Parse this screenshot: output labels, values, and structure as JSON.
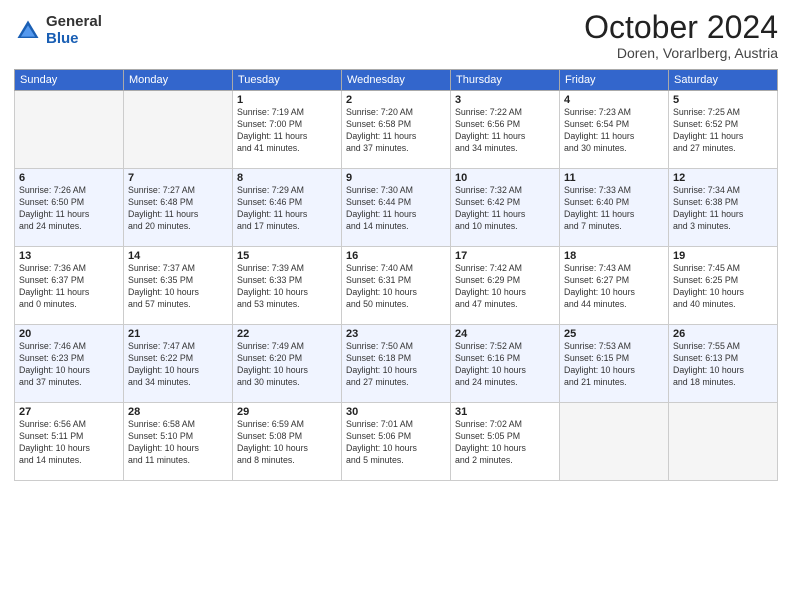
{
  "header": {
    "logo_general": "General",
    "logo_blue": "Blue",
    "month_title": "October 2024",
    "subtitle": "Doren, Vorarlberg, Austria"
  },
  "weekdays": [
    "Sunday",
    "Monday",
    "Tuesday",
    "Wednesday",
    "Thursday",
    "Friday",
    "Saturday"
  ],
  "weeks": [
    [
      {
        "day": "",
        "details": []
      },
      {
        "day": "",
        "details": []
      },
      {
        "day": "1",
        "details": [
          "Sunrise: 7:19 AM",
          "Sunset: 7:00 PM",
          "Daylight: 11 hours",
          "and 41 minutes."
        ]
      },
      {
        "day": "2",
        "details": [
          "Sunrise: 7:20 AM",
          "Sunset: 6:58 PM",
          "Daylight: 11 hours",
          "and 37 minutes."
        ]
      },
      {
        "day": "3",
        "details": [
          "Sunrise: 7:22 AM",
          "Sunset: 6:56 PM",
          "Daylight: 11 hours",
          "and 34 minutes."
        ]
      },
      {
        "day": "4",
        "details": [
          "Sunrise: 7:23 AM",
          "Sunset: 6:54 PM",
          "Daylight: 11 hours",
          "and 30 minutes."
        ]
      },
      {
        "day": "5",
        "details": [
          "Sunrise: 7:25 AM",
          "Sunset: 6:52 PM",
          "Daylight: 11 hours",
          "and 27 minutes."
        ]
      }
    ],
    [
      {
        "day": "6",
        "details": [
          "Sunrise: 7:26 AM",
          "Sunset: 6:50 PM",
          "Daylight: 11 hours",
          "and 24 minutes."
        ]
      },
      {
        "day": "7",
        "details": [
          "Sunrise: 7:27 AM",
          "Sunset: 6:48 PM",
          "Daylight: 11 hours",
          "and 20 minutes."
        ]
      },
      {
        "day": "8",
        "details": [
          "Sunrise: 7:29 AM",
          "Sunset: 6:46 PM",
          "Daylight: 11 hours",
          "and 17 minutes."
        ]
      },
      {
        "day": "9",
        "details": [
          "Sunrise: 7:30 AM",
          "Sunset: 6:44 PM",
          "Daylight: 11 hours",
          "and 14 minutes."
        ]
      },
      {
        "day": "10",
        "details": [
          "Sunrise: 7:32 AM",
          "Sunset: 6:42 PM",
          "Daylight: 11 hours",
          "and 10 minutes."
        ]
      },
      {
        "day": "11",
        "details": [
          "Sunrise: 7:33 AM",
          "Sunset: 6:40 PM",
          "Daylight: 11 hours",
          "and 7 minutes."
        ]
      },
      {
        "day": "12",
        "details": [
          "Sunrise: 7:34 AM",
          "Sunset: 6:38 PM",
          "Daylight: 11 hours",
          "and 3 minutes."
        ]
      }
    ],
    [
      {
        "day": "13",
        "details": [
          "Sunrise: 7:36 AM",
          "Sunset: 6:37 PM",
          "Daylight: 11 hours",
          "and 0 minutes."
        ]
      },
      {
        "day": "14",
        "details": [
          "Sunrise: 7:37 AM",
          "Sunset: 6:35 PM",
          "Daylight: 10 hours",
          "and 57 minutes."
        ]
      },
      {
        "day": "15",
        "details": [
          "Sunrise: 7:39 AM",
          "Sunset: 6:33 PM",
          "Daylight: 10 hours",
          "and 53 minutes."
        ]
      },
      {
        "day": "16",
        "details": [
          "Sunrise: 7:40 AM",
          "Sunset: 6:31 PM",
          "Daylight: 10 hours",
          "and 50 minutes."
        ]
      },
      {
        "day": "17",
        "details": [
          "Sunrise: 7:42 AM",
          "Sunset: 6:29 PM",
          "Daylight: 10 hours",
          "and 47 minutes."
        ]
      },
      {
        "day": "18",
        "details": [
          "Sunrise: 7:43 AM",
          "Sunset: 6:27 PM",
          "Daylight: 10 hours",
          "and 44 minutes."
        ]
      },
      {
        "day": "19",
        "details": [
          "Sunrise: 7:45 AM",
          "Sunset: 6:25 PM",
          "Daylight: 10 hours",
          "and 40 minutes."
        ]
      }
    ],
    [
      {
        "day": "20",
        "details": [
          "Sunrise: 7:46 AM",
          "Sunset: 6:23 PM",
          "Daylight: 10 hours",
          "and 37 minutes."
        ]
      },
      {
        "day": "21",
        "details": [
          "Sunrise: 7:47 AM",
          "Sunset: 6:22 PM",
          "Daylight: 10 hours",
          "and 34 minutes."
        ]
      },
      {
        "day": "22",
        "details": [
          "Sunrise: 7:49 AM",
          "Sunset: 6:20 PM",
          "Daylight: 10 hours",
          "and 30 minutes."
        ]
      },
      {
        "day": "23",
        "details": [
          "Sunrise: 7:50 AM",
          "Sunset: 6:18 PM",
          "Daylight: 10 hours",
          "and 27 minutes."
        ]
      },
      {
        "day": "24",
        "details": [
          "Sunrise: 7:52 AM",
          "Sunset: 6:16 PM",
          "Daylight: 10 hours",
          "and 24 minutes."
        ]
      },
      {
        "day": "25",
        "details": [
          "Sunrise: 7:53 AM",
          "Sunset: 6:15 PM",
          "Daylight: 10 hours",
          "and 21 minutes."
        ]
      },
      {
        "day": "26",
        "details": [
          "Sunrise: 7:55 AM",
          "Sunset: 6:13 PM",
          "Daylight: 10 hours",
          "and 18 minutes."
        ]
      }
    ],
    [
      {
        "day": "27",
        "details": [
          "Sunrise: 6:56 AM",
          "Sunset: 5:11 PM",
          "Daylight: 10 hours",
          "and 14 minutes."
        ]
      },
      {
        "day": "28",
        "details": [
          "Sunrise: 6:58 AM",
          "Sunset: 5:10 PM",
          "Daylight: 10 hours",
          "and 11 minutes."
        ]
      },
      {
        "day": "29",
        "details": [
          "Sunrise: 6:59 AM",
          "Sunset: 5:08 PM",
          "Daylight: 10 hours",
          "and 8 minutes."
        ]
      },
      {
        "day": "30",
        "details": [
          "Sunrise: 7:01 AM",
          "Sunset: 5:06 PM",
          "Daylight: 10 hours",
          "and 5 minutes."
        ]
      },
      {
        "day": "31",
        "details": [
          "Sunrise: 7:02 AM",
          "Sunset: 5:05 PM",
          "Daylight: 10 hours",
          "and 2 minutes."
        ]
      },
      {
        "day": "",
        "details": []
      },
      {
        "day": "",
        "details": []
      }
    ]
  ]
}
